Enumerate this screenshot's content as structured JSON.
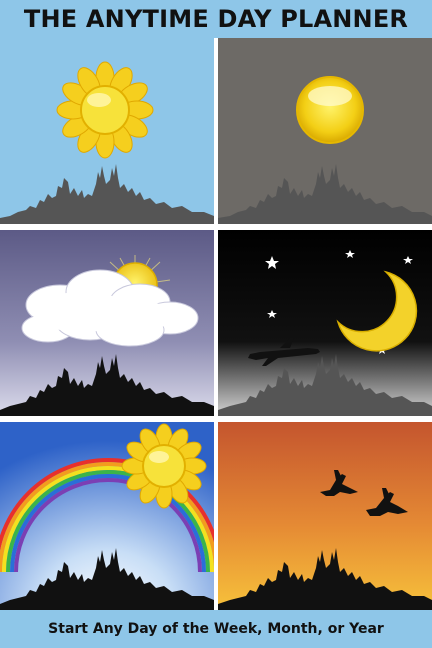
{
  "title": "THE ANYTIME DAY PLANNER",
  "tagline": "Start Any Day of the Week, Month, or Year",
  "colors": {
    "background": "#8ec6e8",
    "sun": "#f5d21a",
    "moon": "#f3d22a",
    "skyline_light": "#555555",
    "skyline_dark": "#111111",
    "sunset_top": "#c4552e",
    "sunset_bottom": "#f7c23b"
  },
  "panels": [
    {
      "scene": "morning-sun",
      "sky": "light-blue"
    },
    {
      "scene": "full-sun",
      "sky": "grey"
    },
    {
      "scene": "sun-behind-clouds",
      "sky": "purple-dusk"
    },
    {
      "scene": "night-moon-stars-airplane",
      "sky": "black"
    },
    {
      "scene": "rainbow-sun",
      "sky": "blue"
    },
    {
      "scene": "sunset-flying-birds",
      "sky": "orange"
    }
  ]
}
